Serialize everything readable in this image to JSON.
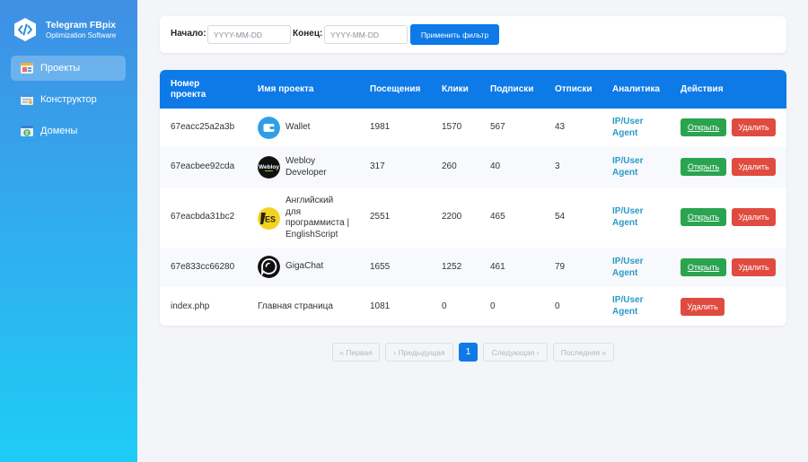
{
  "app": {
    "title": "Telegram FBpix",
    "subtitle": "Optimization Software"
  },
  "sidebar": {
    "items": [
      {
        "label": "Проекты",
        "icon": "projects-icon",
        "active": true
      },
      {
        "label": "Конструктор",
        "icon": "constructor-icon",
        "active": false
      },
      {
        "label": "Домены",
        "icon": "domains-icon",
        "active": false
      }
    ]
  },
  "filter": {
    "start_label": "Начало:",
    "start_placeholder": "YYYY-MM-DD",
    "start_value": "",
    "end_label": "Конец:",
    "end_placeholder": "YYYY-MM-DD",
    "end_value": "",
    "apply_label": "Применить фильтр"
  },
  "table": {
    "headers": {
      "id": "Номер проекта",
      "name": "Имя проекта",
      "visits": "Посещения",
      "clicks": "Клики",
      "subs": "Подписки",
      "unsubs": "Отписки",
      "analytics": "Аналитика",
      "actions": "Действия"
    },
    "rows": [
      {
        "id": "67eacc25a2a3b",
        "name": "Wallet",
        "icon": "wallet-icon",
        "visits": "1981",
        "clicks": "1570",
        "subs": "567",
        "unsubs": "43",
        "analytics": "IP/User Agent",
        "open": "Открыть",
        "delete": "Удалить"
      },
      {
        "id": "67eacbee92cda",
        "name": "Webloy Developer",
        "icon": "webloy-icon",
        "visits": "317",
        "clicks": "260",
        "subs": "40",
        "unsubs": "3",
        "analytics": "IP/User Agent",
        "open": "Открыть",
        "delete": "Удалить"
      },
      {
        "id": "67eacbda31bc2",
        "name": "Английский для программиста | EnglishScript",
        "icon": "englishscript-icon",
        "visits": "2551",
        "clicks": "2200",
        "subs": "465",
        "unsubs": "54",
        "analytics": "IP/User Agent",
        "open": "Открыть",
        "delete": "Удалить"
      },
      {
        "id": "67e833cc66280",
        "name": "GigaChat",
        "icon": "gigachat-icon",
        "visits": "1655",
        "clicks": "1252",
        "subs": "461",
        "unsubs": "79",
        "analytics": "IP/User Agent",
        "open": "Открыть",
        "delete": "Удалить"
      },
      {
        "id": "index.php",
        "name": "Главная страница",
        "visits": "1081",
        "clicks": "0",
        "subs": "0",
        "unsubs": "0",
        "analytics": "IP/User Agent",
        "delete": "Удалить"
      }
    ]
  },
  "pagination": {
    "first": "« Первая",
    "prev": "‹ Предыдущая",
    "current": "1",
    "next": "Следующая ›",
    "last": "Последняя »"
  },
  "colors": {
    "accent": "#0d7ae8",
    "open_button": "#2aa44f",
    "delete_button": "#e04b40",
    "link": "#2a9bc8",
    "sidebar_top": "#3f8fe4",
    "sidebar_bottom": "#1ecdf6"
  }
}
